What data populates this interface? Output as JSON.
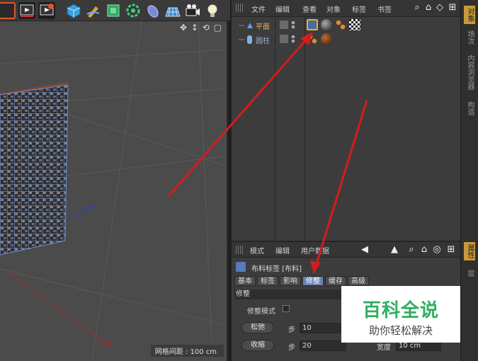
{
  "toolbar": {
    "icons": [
      "render-region-icon",
      "render-view-icon",
      "render-settings-icon",
      "cube-icon",
      "pen-icon",
      "subdivision-icon",
      "array-icon",
      "deformer-icon",
      "floor-icon",
      "camera-icon",
      "light-icon"
    ]
  },
  "viewport": {
    "nav_icons": "✥ ↕ ⟲ ▢",
    "grid_status": "网格间距 : 100 cm"
  },
  "object_manager": {
    "menu": [
      "文件",
      "编辑",
      "查看",
      "对象",
      "标签",
      "书签"
    ],
    "objects": [
      {
        "name": "平面",
        "color": "#e6b24a"
      },
      {
        "name": "圆柱",
        "color": "#9ab0d8"
      }
    ]
  },
  "right_tabs": {
    "top": [
      "对象",
      "场次",
      "内容浏览器",
      "构造"
    ],
    "bottom": [
      "属性",
      "层"
    ]
  },
  "attribute_manager": {
    "menu": [
      "模式",
      "编辑",
      "用户数据"
    ],
    "title": "布料标签 [布料]",
    "tabs": [
      "基本",
      "标签",
      "影响",
      "修整",
      "缓存",
      "高级"
    ],
    "active_tab": "修整",
    "section": "修整",
    "dress_mode_label": "修整模式",
    "relax_button": "松弛",
    "relax_steps_label": "步",
    "relax_steps": "10",
    "shrink_button": "收缩",
    "shrink_steps_label": "步",
    "shrink_steps": "20",
    "width_label": "宽度",
    "width_value": "10 cm"
  },
  "watermark": {
    "title": "百科全说",
    "subtitle": "助你轻松解决"
  },
  "colors": {
    "accent": "#c89a3a",
    "arrow": "#d41c1c",
    "active_tab": "#6a85b3"
  }
}
